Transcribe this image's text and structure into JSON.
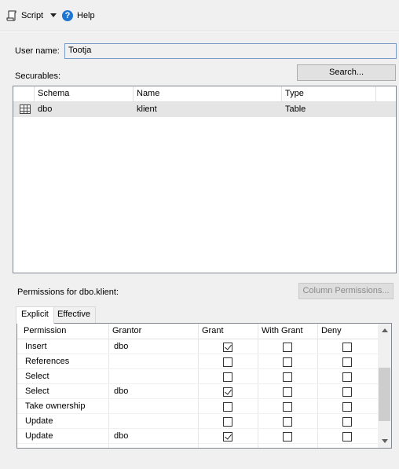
{
  "toolbar": {
    "script_label": "Script",
    "help_label": "Help"
  },
  "user": {
    "label": "User name:",
    "value": "Tootja"
  },
  "securables": {
    "label": "Securables:",
    "search_button": "Search...",
    "columns": [
      "Schema",
      "Name",
      "Type"
    ],
    "rows": [
      {
        "schema": "dbo",
        "name": "klient",
        "type": "Table"
      }
    ]
  },
  "permissions": {
    "label": "Permissions for dbo.klient:",
    "column_permissions_button": "Column Permissions...",
    "tabs": [
      "Explicit",
      "Effective"
    ],
    "active_tab": "Explicit",
    "columns": [
      "Permission",
      "Grantor",
      "Grant",
      "With Grant",
      "Deny"
    ],
    "rows": [
      {
        "permission": "Insert",
        "grantor": "dbo",
        "grant": true,
        "with_grant": false,
        "deny": false
      },
      {
        "permission": "References",
        "grantor": "",
        "grant": false,
        "with_grant": false,
        "deny": false
      },
      {
        "permission": "Select",
        "grantor": "",
        "grant": false,
        "with_grant": false,
        "deny": false
      },
      {
        "permission": "Select",
        "grantor": "dbo",
        "grant": true,
        "with_grant": false,
        "deny": false
      },
      {
        "permission": "Take ownership",
        "grantor": "",
        "grant": false,
        "with_grant": false,
        "deny": false
      },
      {
        "permission": "Update",
        "grantor": "",
        "grant": false,
        "with_grant": false,
        "deny": false
      },
      {
        "permission": "Update",
        "grantor": "dbo",
        "grant": true,
        "with_grant": false,
        "deny": false
      }
    ]
  }
}
